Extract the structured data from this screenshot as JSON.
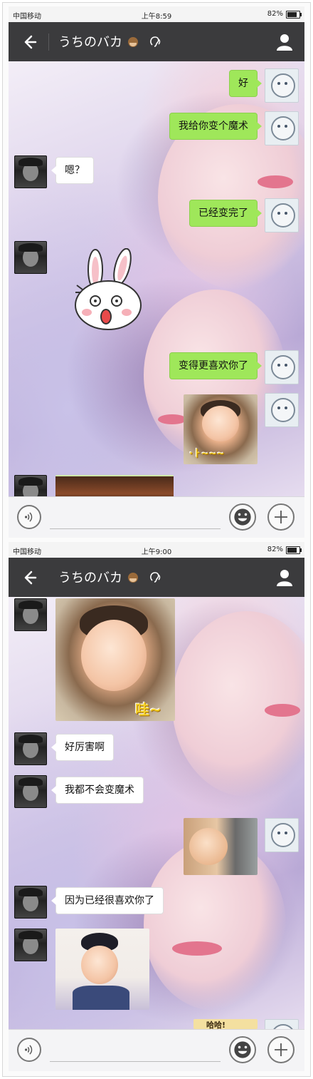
{
  "screens": [
    {
      "status": {
        "carrier": "中国移动",
        "time": "上午8:59",
        "battery": "82%"
      },
      "header": {
        "title": "うちのバカ"
      },
      "messages": [
        {
          "type": "text",
          "side": "right",
          "text": "好"
        },
        {
          "type": "text",
          "side": "right",
          "text": "我给你变个魔术"
        },
        {
          "type": "text",
          "side": "left",
          "text": "嗯？"
        },
        {
          "type": "text",
          "side": "right",
          "text": "已经变完了"
        },
        {
          "type": "sticker",
          "side": "left",
          "sticker": "shocked-rabbit"
        },
        {
          "type": "text",
          "side": "right",
          "text": "变得更喜欢你了"
        },
        {
          "type": "sticker",
          "side": "right",
          "sticker": "smiling-kid",
          "caption": "·ㅏ~~~"
        },
        {
          "type": "sticker",
          "side": "left",
          "sticker": "partial-photo"
        }
      ]
    },
    {
      "status": {
        "carrier": "中国移动",
        "time": "上午9:00",
        "battery": "82%"
      },
      "header": {
        "title": "うちのバカ"
      },
      "messages": [
        {
          "type": "sticker",
          "side": "left",
          "sticker": "baby-wa",
          "caption": "哇~"
        },
        {
          "type": "text",
          "side": "left",
          "text": "好厉害啊"
        },
        {
          "type": "text",
          "side": "left",
          "text": "我都不会变魔术"
        },
        {
          "type": "sticker",
          "side": "right",
          "sticker": "laughing-baby"
        },
        {
          "type": "text",
          "side": "left",
          "text": "因为已经很喜欢你了"
        },
        {
          "type": "sticker",
          "side": "left",
          "sticker": "kid-hat"
        },
        {
          "type": "sticker",
          "side": "right",
          "sticker": "partial-sticker",
          "caption": "哈哈!"
        }
      ]
    }
  ],
  "colors": {
    "navbar": "#3b3b3d",
    "bubble_out": "#9fe75a",
    "bubble_in": "#ffffff"
  },
  "icons": [
    "back-arrow-icon",
    "monkey-emoji-icon",
    "earpiece-icon",
    "profile-icon",
    "voice-icon",
    "emoji-icon",
    "plus-icon"
  ]
}
